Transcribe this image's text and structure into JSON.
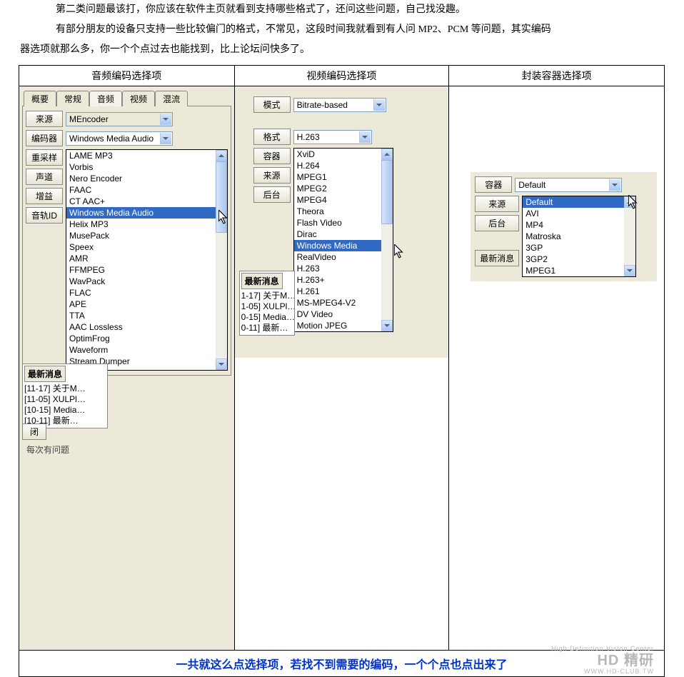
{
  "paragraphs": {
    "p1": "第二类问题最该打，你应该在软件主页就看到支持哪些格式了，还问这些问题，自己找没趣。",
    "p2a": "有部分朋友的设备只支持一些比较偏门的格式，不常见，这段时间我就看到有人问 MP2、PCM 等问题，其实编码",
    "p2b": "器选项就那么多，你一个个点过去也能找到，比上论坛问快多了。"
  },
  "headers": {
    "audio": "音频编码选择项",
    "video": "视频编码选择项",
    "container": "封装容器选择项"
  },
  "audio_panel": {
    "tabs": {
      "summary": "概要",
      "common": "常规",
      "audio": "音频",
      "video": "视频",
      "mux": "混流"
    },
    "labels": {
      "source": "来源",
      "encoder": "编码器",
      "resample": "重采样",
      "channel": "声道",
      "gain": "增益",
      "trackid": "音轨ID"
    },
    "source_value": "MEncoder",
    "encoder_value": "Windows Media Audio",
    "dropdown": [
      "LAME MP3",
      "Vorbis",
      "Nero Encoder",
      "FAAC",
      "CT AAC+",
      "Windows Media Audio",
      "Helix MP3",
      "MusePack",
      "Speex",
      "AMR",
      "FFMPEG",
      "WavPack",
      "FLAC",
      "APE",
      "TTA",
      "AAC Lossless",
      "OptimFrog",
      "Waveform",
      "Stream Dumper"
    ],
    "selected": "Windows Media Audio",
    "news_label": "最新消息",
    "news": [
      "[11-17] 关于M…",
      "[11-05] XULPl…",
      "[10-15] Media…",
      "[10-11] 最新…"
    ],
    "close": "闭",
    "bottombar": "每次有问题"
  },
  "video_panel": {
    "labels": {
      "mode": "模式",
      "format": "格式",
      "container": "容器",
      "source": "来源",
      "background": "后台"
    },
    "mode_value": "Bitrate-based",
    "format_value": "H.263",
    "dropdown": [
      "XviD",
      "H.264",
      "MPEG1",
      "MPEG2",
      "MPEG4",
      "Theora",
      "Flash Video",
      "Dirac",
      "Windows Media",
      "RealVideo",
      "H.263",
      "H.263+",
      "H.261",
      "MS-MPEG4-V2",
      "DV Video",
      "Motion JPEG"
    ],
    "selected": "Windows Media",
    "news_label": "最新消息",
    "news": [
      "1-17] 关于M…",
      "1-05] XULPl…",
      "0-15] Media…",
      "0-11] 最新…"
    ]
  },
  "container_panel": {
    "labels": {
      "container": "容器",
      "source": "来源",
      "background": "后台"
    },
    "container_value": "Default",
    "dropdown": [
      "Default",
      "AVI",
      "MP4",
      "Matroska",
      "3GP",
      "3GP2",
      "MPEG1"
    ],
    "selected": "Default",
    "news_label": "最新消息"
  },
  "footer": "一共就这么点选择项，若找不到需要的编码，一个个点也点出来了",
  "watermark": {
    "tag": "High Definition Vision Center",
    "brand": "HD 精研",
    "url": "WWW.HD-CLUB.TW"
  }
}
